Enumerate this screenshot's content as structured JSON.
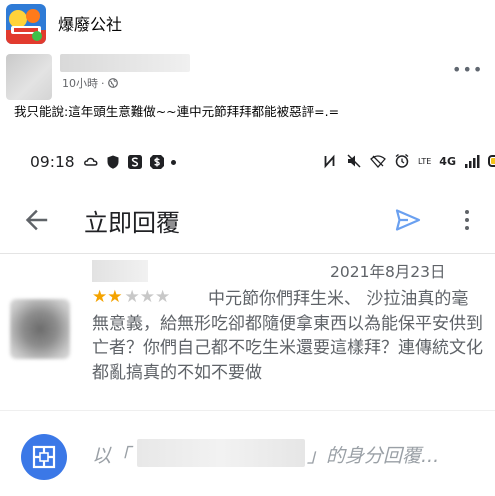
{
  "group": {
    "name": "爆廢公社"
  },
  "post": {
    "time": "10小時",
    "separator": "·",
    "more_label": "•••",
    "text": "我只能說:這年頭生意難做~~連中元節拜拜都能被惡評=.="
  },
  "screenshot": {
    "status_time": "09:18",
    "status_network": "4G",
    "status_lte": "LTE",
    "title": "立即回覆",
    "review": {
      "date": "2021年8月23日",
      "rating": 2,
      "rating_max": 5,
      "star_on": "★★",
      "star_off": "★★★",
      "first_line": "中元節你們拜生米、 沙拉油",
      "rest": "真的毫無意義，給無形吃卻都隨便拿東西以為能保平安供到亡者？你們自己都不吃生米還要這樣拜？連傳統文化都亂搞真的不如不要做"
    },
    "reply": {
      "prefix": "以「",
      "suffix": "」的身分回覆..."
    }
  },
  "colors": {
    "star_on": "#f4a300",
    "star_off": "#c8c8c8",
    "send": "#6aa0f0",
    "reply_avatar": "#3b78e7"
  },
  "icons": {
    "back": "arrow-left-icon",
    "send": "send-icon",
    "more": "kebab-icon",
    "globe": "globe-icon"
  }
}
